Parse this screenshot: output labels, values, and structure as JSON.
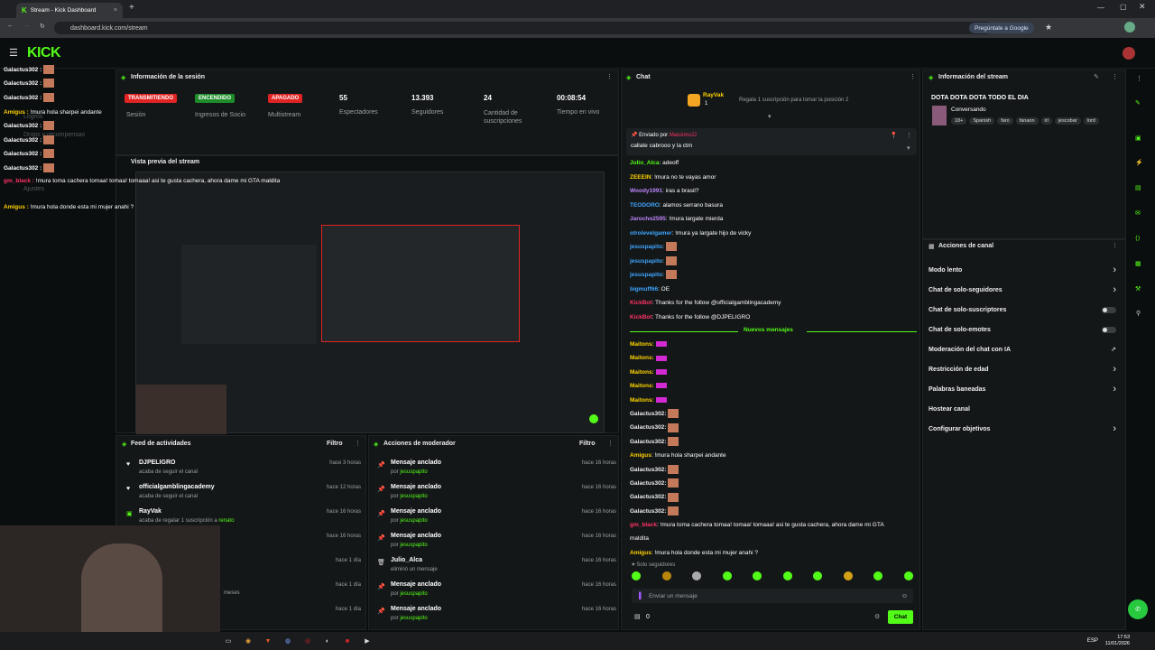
{
  "browser": {
    "tab_title": "Stream - Kick Dashboard",
    "url": "dashboard.kick.com/stream",
    "google_btn": "Pregúntale a Google"
  },
  "kick": {
    "logo": "KICK"
  },
  "overlay_chat": [
    {
      "user": "Galactus302 :",
      "text": ""
    },
    {
      "user": "Galactus302 :",
      "text": ""
    },
    {
      "user": "Galactus302 :",
      "text": ""
    },
    {
      "user": "Amigus :",
      "text": "!mura hola sharpei andante"
    },
    {
      "user": "Galactus302 :",
      "text": ""
    },
    {
      "user": "Galactus302 :",
      "text": ""
    },
    {
      "user": "Galactus302 :",
      "text": ""
    },
    {
      "user": "Galactus302 :",
      "text": ""
    },
    {
      "user": "gm_black :",
      "text": "!mura toma cachera tomaa! tomaa! tomaaa! asi te gusta cachera, ahora dame mi GTA maldita"
    },
    {
      "user": "Amigus :",
      "text": "!mura hola donde esta mi mujer anahi ?"
    }
  ],
  "sidebar_ghost": {
    "a": "Logros",
    "b": "Drops y recompensas",
    "c": "Ajustes",
    "d": "Canal"
  },
  "stream_info_panel": {
    "title": "Información de la sesión",
    "status_live": "TRANSMITIENDO",
    "status_on": "ENCENDIDO",
    "status_off": "APAGADO",
    "lbl_session": "Sesión",
    "lbl_partner": "Ingresos de Socio",
    "lbl_multistream": "Multistream",
    "viewers": "55",
    "viewers_lbl": "Espectadores",
    "followers": "13.393",
    "followers_lbl": "Seguidores",
    "subs": "24",
    "subs_lbl": "Cantidad de suscripciones",
    "time": "00:08:54",
    "time_lbl": "Tiempo en vivo"
  },
  "preview": {
    "title": "Vista previa del stream"
  },
  "activity": {
    "title": "Feed de actividades",
    "filter": "Filtro",
    "items": [
      {
        "name": "DJPELIGRO",
        "desc": "acaba de seguir el canal",
        "time": "hace 3 horas"
      },
      {
        "name": "officialgamblingacademy",
        "desc": "acaba de seguir el canal",
        "time": "hace 12 horas"
      },
      {
        "name": "RayVak",
        "desc": "acaba de regalar 1 suscripción a",
        "desc2": "renato",
        "time": "hace 16 horas"
      },
      {
        "name": "",
        "desc": "",
        "time": "hace 16 horas"
      },
      {
        "name": "",
        "desc": "",
        "time": "hace 1 día"
      },
      {
        "name": "",
        "desc": "meses",
        "time": "hace 1 día"
      },
      {
        "name": "",
        "desc": "",
        "time": "hace 1 día"
      }
    ]
  },
  "mod_actions": {
    "title": "Acciones de moderador",
    "filter": "Filtro",
    "items": [
      {
        "name": "Mensaje anclado",
        "by": "por",
        "who": "jesuspapito",
        "time": "hace 16 horas"
      },
      {
        "name": "Mensaje anclado",
        "by": "por",
        "who": "jesuspapito",
        "time": "hace 16 horas"
      },
      {
        "name": "Mensaje anclado",
        "by": "por",
        "who": "jesuspapito",
        "time": "hace 16 horas"
      },
      {
        "name": "Mensaje anclado",
        "by": "por",
        "who": "jesuspapito",
        "time": "hace 16 horas"
      },
      {
        "name": "Julio_Alca",
        "by": "eliminó un mensaje",
        "who": "",
        "time": "hace 16 horas"
      },
      {
        "name": "Mensaje anclado",
        "by": "por",
        "who": "jesuspapito",
        "time": "hace 16 horas"
      },
      {
        "name": "Mensaje anclado",
        "by": "por",
        "who": "jesuspapito",
        "time": "hace 16 horas"
      }
    ]
  },
  "chat": {
    "title": "Chat",
    "top_gifter": "RayVak",
    "top_gifter_count": "1",
    "gift_prompt": "Regala 1 suscripción para tomar la posición 2",
    "pinned_by": "Enviado por",
    "pinned_user": "MassimoJJ",
    "pinned_text": "callate cabrooo y la ctm",
    "new_messages": "Nuevos mensajes",
    "followers_only": "Solo seguidores",
    "input_placeholder": "Enviar un mensaje",
    "send": "Chat",
    "counter": "0",
    "messages": [
      {
        "user": "Julio_Alca",
        "text": ": adeoff",
        "color": "#53fc18"
      },
      {
        "user": "ZEEEIN",
        "text": ": !mura no te vayas amor",
        "color": "#ffd400"
      },
      {
        "user": "Woody1991",
        "text": ": iras a brasil?",
        "color": "#bb86fc"
      },
      {
        "user": "TEODORO",
        "text": ": alamos serrano basura",
        "color": "#3ea6ff"
      },
      {
        "user": "Jarocho2595",
        "text": ": !mura largate mierda",
        "color": "#bb86fc"
      },
      {
        "user": "otrolevelgamer",
        "text": ": !mura ya largate hijo de vicky",
        "color": "#3ea6ff"
      },
      {
        "user": "jesuspapito",
        "text": ":",
        "color": "#3ea6ff"
      },
      {
        "user": "jesuspapito",
        "text": ":",
        "color": "#3ea6ff"
      },
      {
        "user": "jesuspapito",
        "text": ":",
        "color": "#3ea6ff"
      },
      {
        "user": "bigmuff66",
        "text": ": OE",
        "color": "#3ea6ff"
      },
      {
        "user": "KickBot",
        "text": ": Thanks for the follow @officialgamblingacademy",
        "color": "#ff3366"
      },
      {
        "user": "KickBot",
        "text": ": Thanks for the follow @DJPELIGRO",
        "color": "#ff3366"
      }
    ],
    "messages2": [
      {
        "user": "Maitons:",
        "text": "",
        "color": "#ffd400"
      },
      {
        "user": "Maitons:",
        "text": "",
        "color": "#ffd400"
      },
      {
        "user": "Maitons:",
        "text": "",
        "color": "#ffd400"
      },
      {
        "user": "Maitons:",
        "text": "",
        "color": "#ffd400"
      },
      {
        "user": "Maitons:",
        "text": "",
        "color": "#ffd400"
      },
      {
        "user": "Galactus302:",
        "text": "",
        "color": "#eee"
      },
      {
        "user": "Galactus302:",
        "text": "",
        "color": "#eee"
      },
      {
        "user": "Galactus302:",
        "text": "",
        "color": "#eee"
      },
      {
        "user": "Amigus",
        "text": ": !mura hola sharpei andante",
        "color": "#ffd400"
      },
      {
        "user": "Galactus302:",
        "text": "",
        "color": "#eee"
      },
      {
        "user": "Galactus302:",
        "text": "",
        "color": "#eee"
      },
      {
        "user": "Galactus302:",
        "text": "",
        "color": "#eee"
      },
      {
        "user": "Galactus302:",
        "text": "",
        "color": "#eee"
      },
      {
        "user": "gm_black",
        "text": ": !mura toma cachera tomaa! tomaa! tomaaa! asi te gusta cachera, ahora dame mi GTA",
        "color": "#ff3366"
      },
      {
        "user": "",
        "text": "maldita",
        "color": "#eee"
      },
      {
        "user": "Amigus",
        "text": ": !mura hola donde esta mi mujer anahi ?",
        "color": "#ffd400"
      }
    ]
  },
  "stream_info": {
    "title": "Información del stream",
    "stream_title": "DOTA DOTA DOTA TODO EL DIA",
    "category": "Conversando",
    "tags": [
      "18+",
      "Spanish",
      "faro",
      "fanaon",
      "irl",
      "jescobar",
      "lord"
    ]
  },
  "channel_actions": {
    "title": "Acciones de canal",
    "items": [
      {
        "label": "Modo lento",
        "kind": "arrow"
      },
      {
        "label": "Chat de solo-seguidores",
        "kind": "arrow"
      },
      {
        "label": "Chat de solo-suscriptores",
        "kind": "toggle"
      },
      {
        "label": "Chat de solo-emotes",
        "kind": "toggle"
      },
      {
        "label": "Moderación del chat con IA",
        "kind": "ext"
      },
      {
        "label": "Restricción de edad",
        "kind": "arrow"
      },
      {
        "label": "Palabras baneadas",
        "kind": "arrow"
      },
      {
        "label": "Hostear canal",
        "kind": "none"
      },
      {
        "label": "Configurar objetivos",
        "kind": "arrow"
      }
    ]
  },
  "taskbar": {
    "time": "17:53",
    "date": "11/01/2026",
    "lang": "ESP"
  }
}
